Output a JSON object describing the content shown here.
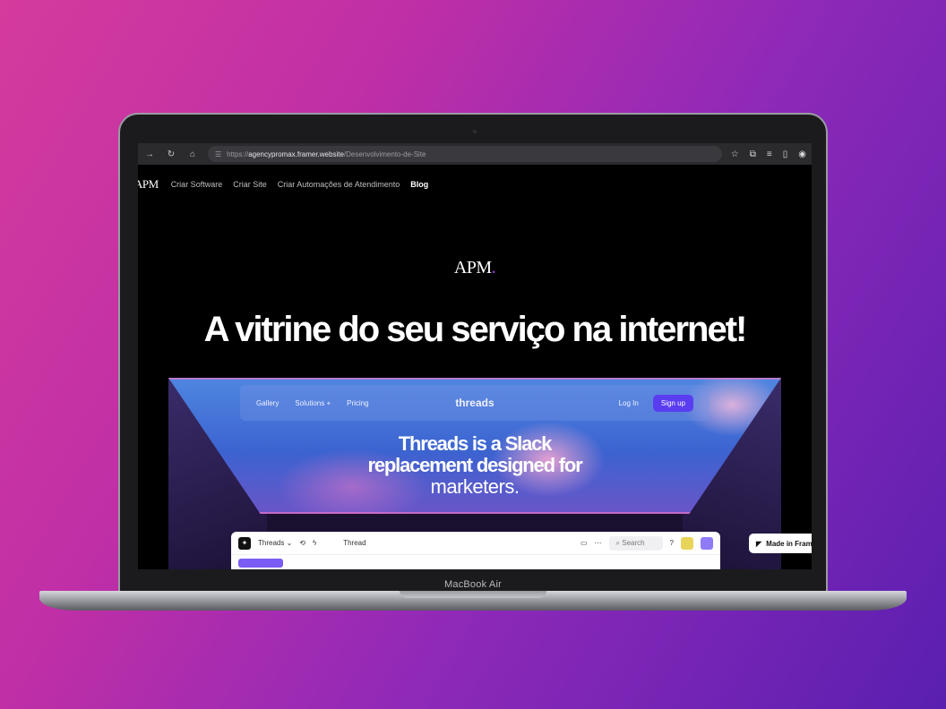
{
  "browser": {
    "url_prefix": "https://",
    "url_host": "agencypromax.framer.website",
    "url_path": "/Desenvolvimento-de-Site",
    "nav_icons": [
      "forward-icon",
      "reload-icon",
      "home-icon",
      "site-info-icon"
    ],
    "right_icons": [
      "star-icon",
      "extensions-icon",
      "playlist-icon",
      "sidebar-icon",
      "profile-icon"
    ]
  },
  "site": {
    "logo": "APM",
    "nav": [
      "Criar Software",
      "Criar Site",
      "Criar Automações de Atendimento",
      "Blog"
    ],
    "hero_logo": "APM",
    "hero_logo_dot": ".",
    "hero_title": "A vitrine do seu serviço na internet!"
  },
  "showcase": {
    "nav_links": [
      "Gallery",
      "Solutions +",
      "Pricing"
    ],
    "brand": "threads",
    "login": "Log In",
    "signup": "Sign up",
    "headline_line1": "Threads is a Slack",
    "headline_line2": "replacement designed for",
    "headline_line3": "marketers.",
    "app": {
      "workspace": "Threads ⌄",
      "title": "Thread",
      "search_placeholder": "Search"
    }
  },
  "badge": {
    "made_in": "Made in Framer"
  },
  "laptop": {
    "label": "MacBook Air"
  }
}
